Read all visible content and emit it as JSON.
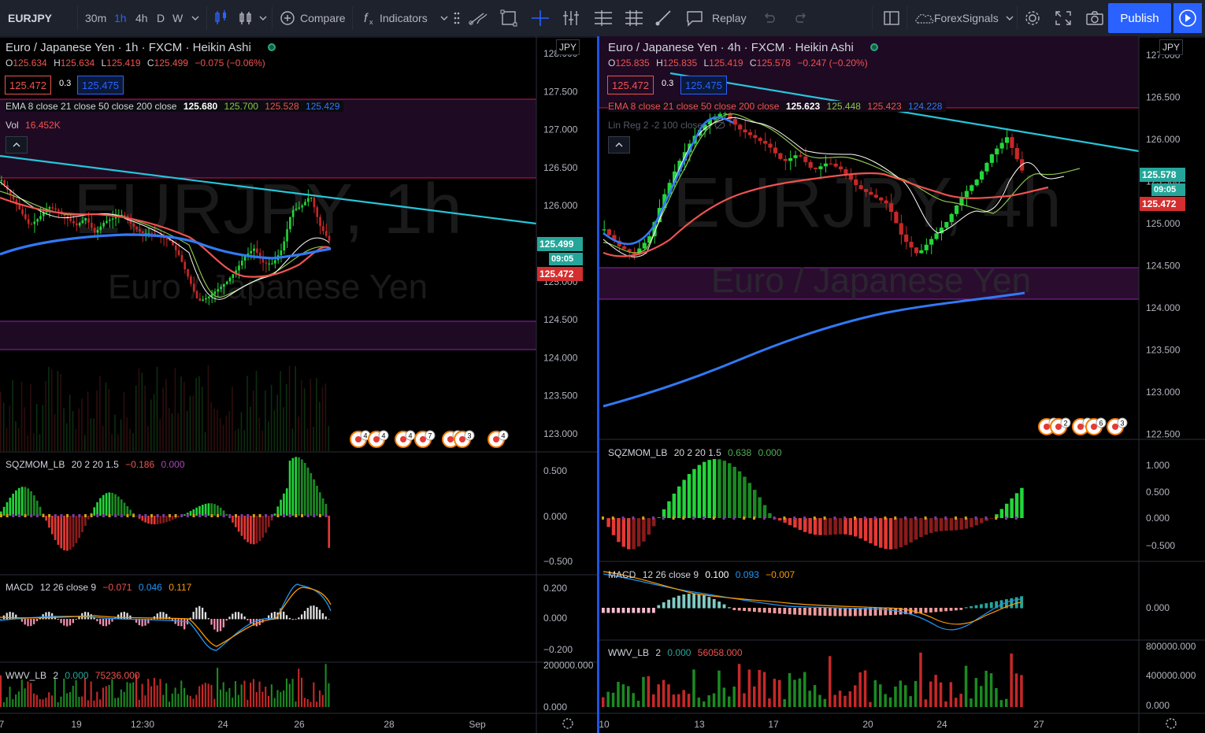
{
  "toolbar": {
    "symbol": "EURJPY",
    "intervals": [
      "30m",
      "1h",
      "4h",
      "D",
      "W"
    ],
    "active_interval": "1h",
    "compare_label": "Compare",
    "indicators_label": "Indicators",
    "replay_label": "Replay",
    "signals_label": "ForexSignals",
    "publish_label": "Publish"
  },
  "left": {
    "title": "Euro / Japanese Yen · 1h · FXCM · Heikin Ashi",
    "watermark_symbol": "EURJPY, 1h",
    "watermark_name": "Euro / Japanese Yen",
    "ohlc": {
      "o_label": "O",
      "o": "125.634",
      "h_label": "H",
      "h": "125.634",
      "l_label": "L",
      "l": "125.419",
      "c_label": "C",
      "c": "125.499",
      "chg": "−0.075 (−0.06%)"
    },
    "bid": "125.472",
    "spread": "0.3",
    "ask": "125.475",
    "ema": {
      "label": "EMA 8 close 21 close 50 close 200 close",
      "v1": "125.680",
      "v2": "125.700",
      "v3": "125.528",
      "v4": "125.429"
    },
    "vol": {
      "label": "Vol",
      "value": "16.452K"
    },
    "currency": "JPY",
    "price_axis": [
      "128.000",
      "127.500",
      "127.000",
      "126.500",
      "126.000",
      "125.500",
      "125.000",
      "124.500",
      "124.000",
      "123.500",
      "123.000"
    ],
    "last_price": "125.499",
    "countdown": "09:05",
    "bid_tag": "125.472",
    "sqz": {
      "label": "SQZMOM_LB",
      "params": "20 2 20 1.5",
      "v1": "−0.186",
      "v2": "0.000",
      "axis": [
        "0.500",
        "0.000",
        "−0.500"
      ]
    },
    "macd": {
      "label": "MACD",
      "params": "12 26 close 9",
      "v1": "−0.071",
      "v2": "0.046",
      "v3": "0.117",
      "axis": [
        "0.200",
        "0.000",
        "−0.200"
      ]
    },
    "wwv": {
      "label": "WWV_LB",
      "params": "2",
      "v1": "0.000",
      "v2": "75236.000",
      "axis": [
        "200000.000",
        "0.000"
      ]
    },
    "time_axis": [
      "7",
      "19",
      "12:30",
      "24",
      "26",
      "28",
      "Sep"
    ]
  },
  "right": {
    "title": "Euro / Japanese Yen · 4h · FXCM · Heikin Ashi",
    "watermark_symbol": "EURJPY, 4h",
    "watermark_name": "Euro / Japanese Yen",
    "ohlc": {
      "o_label": "O",
      "o": "125.835",
      "h_label": "H",
      "h": "125.835",
      "l_label": "L",
      "l": "125.419",
      "c_label": "C",
      "c": "125.578",
      "chg": "−0.247 (−0.20%)"
    },
    "bid": "125.472",
    "spread": "0.3",
    "ask": "125.475",
    "ema": {
      "label": "EMA 8 close 21 close 50 close 200 close",
      "v1": "125.623",
      "v2": "125.448",
      "v3": "125.423",
      "v4": "124.228"
    },
    "linreg": "Lin Reg 2 -2 100 close",
    "currency": "JPY",
    "price_axis": [
      "127.000",
      "126.500",
      "126.000",
      "125.500",
      "125.000",
      "124.500",
      "124.000",
      "123.500",
      "123.000",
      "122.500"
    ],
    "last_price": "125.578",
    "countdown": "09:05",
    "bid_tag": "125.472",
    "sqz": {
      "label": "SQZMOM_LB",
      "params": "20 2 20 1.5",
      "v1": "0.638",
      "v2": "0.000",
      "axis": [
        "1.000",
        "0.500",
        "0.000",
        "−0.500"
      ]
    },
    "macd": {
      "label": "MACD",
      "params": "12 26 close 9",
      "v1": "0.100",
      "v2": "0.093",
      "v3": "−0.007",
      "axis": [
        "0.000"
      ]
    },
    "wwv": {
      "label": "WWV_LB",
      "params": "2",
      "v1": "0.000",
      "v2": "56058.000",
      "axis": [
        "800000.000",
        "400000.000",
        "0.000"
      ]
    },
    "time_axis": [
      "10",
      "13",
      "17",
      "20",
      "24",
      "27"
    ]
  },
  "event_markers": {
    "left": [
      "4",
      "4",
      "4",
      "7",
      "6",
      "3",
      "4"
    ],
    "right": [
      "3",
      "2",
      "4",
      "6",
      "3"
    ]
  },
  "colors": {
    "up": "#26a69a",
    "green": "#22d63a",
    "red": "#ef5350",
    "ema8": "#ffffff",
    "ema21": "#8bc34a",
    "ema50": "#ef5350",
    "ema200": "#3179f5",
    "trend": "#26c6da",
    "zone": "#2a0d2e"
  },
  "chart_data": [
    {
      "type": "candlestick",
      "title": "Euro / Japanese Yen · 1h · FXCM · Heikin Ashi",
      "ylim": [
        122.9,
        128.0
      ],
      "grid": false,
      "close_path": [
        126.3,
        126.1,
        125.9,
        125.7,
        125.8,
        125.95,
        125.9,
        125.8,
        125.7,
        125.8,
        125.6,
        125.75,
        125.8,
        125.85,
        125.7,
        125.6,
        125.6,
        125.55,
        125.5,
        125.3,
        125.0,
        124.7,
        124.75,
        124.85,
        124.95,
        125.1,
        125.3,
        125.4,
        125.2,
        125.2,
        125.4,
        125.9,
        125.95,
        126.1,
        125.7,
        125.5
      ],
      "zones": [
        [
          126.4,
          127.4
        ],
        [
          124.1,
          124.5
        ]
      ],
      "ema200": [
        125.35,
        125.4,
        125.45,
        125.45,
        125.45,
        125.4,
        125.3,
        125.25,
        125.2,
        125.2,
        125.3,
        125.4
      ]
    },
    {
      "type": "candlestick",
      "title": "Euro / Japanese Yen · 4h · FXCM · Heikin Ashi",
      "ylim": [
        122.4,
        127.2
      ],
      "grid": false,
      "close_path": [
        124.9,
        124.7,
        124.6,
        124.8,
        125.3,
        125.7,
        126.0,
        126.2,
        126.3,
        126.1,
        126.0,
        125.9,
        125.7,
        125.8,
        125.6,
        125.7,
        125.6,
        125.4,
        125.3,
        125.2,
        124.8,
        124.6,
        124.8,
        125.0,
        125.3,
        125.5,
        125.8,
        126.0,
        125.6
      ],
      "zones": [
        [
          126.4,
          127.2
        ],
        [
          124.1,
          124.5
        ]
      ],
      "ema200": [
        122.8,
        123.0,
        123.3,
        123.6,
        123.8,
        124.0,
        124.1,
        124.2,
        124.25
      ]
    }
  ]
}
